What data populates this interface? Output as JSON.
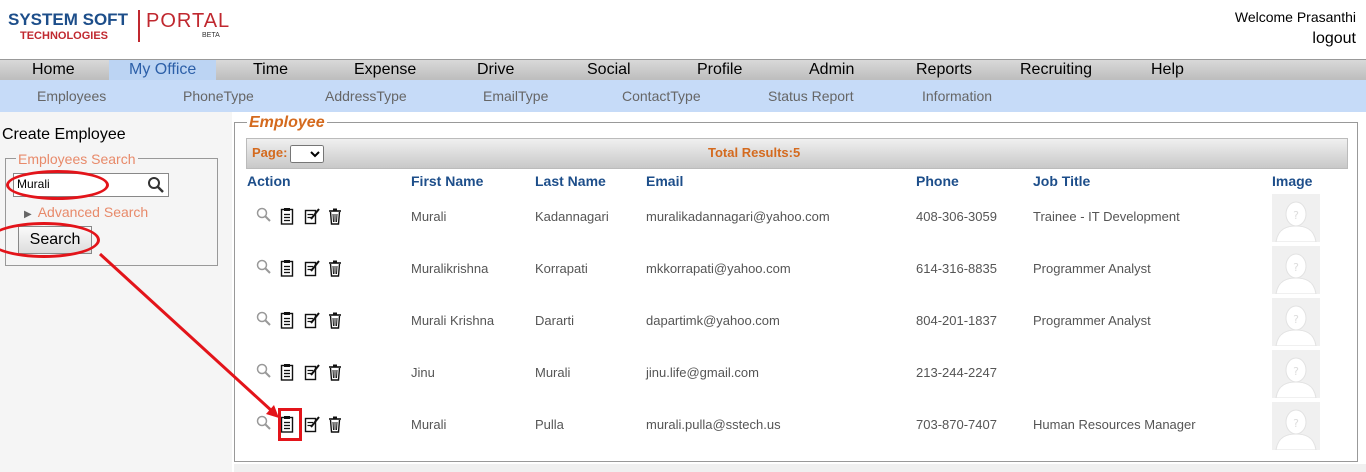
{
  "brand": {
    "line1": "SYSTEM SOFT",
    "line2": "TECHNOLOGIES",
    "portal": "PORTAL",
    "beta": "BETA"
  },
  "user": {
    "welcome": "Welcome Prasanthi",
    "logout": "logout"
  },
  "mainnav": [
    "Home",
    "My Office",
    "Time",
    "Expense",
    "Drive",
    "Social",
    "Profile",
    "Admin",
    "Reports",
    "Recruiting",
    "Help"
  ],
  "mainnav_active": "My Office",
  "subnav": [
    "Employees",
    "PhoneType",
    "AddressType",
    "EmailType",
    "ContactType",
    "Status Report",
    "Information"
  ],
  "left": {
    "create_title": "Create Employee",
    "search_legend": "Employees Search",
    "search_value": "Murali",
    "advanced": "Advanced Search",
    "search_button": "Search"
  },
  "employee": {
    "legend": "Employee",
    "page_label": "Page:",
    "total": "Total Results:5",
    "headers": [
      "Action",
      "First Name",
      "Last Name",
      "Email",
      "Phone",
      "Job Title",
      "Image"
    ],
    "rows": [
      {
        "first": "Murali",
        "last": "Kadannagari",
        "email": "muralikadannagari@yahoo.com",
        "phone": "408-306-3059",
        "job": "Trainee - IT Development"
      },
      {
        "first": "Muralikrishna",
        "last": "Korrapati",
        "email": "mkkorrapati@yahoo.com",
        "phone": "614-316-8835",
        "job": "Programmer Analyst"
      },
      {
        "first": "Murali Krishna",
        "last": "Dararti",
        "email": "dapartimk@yahoo.com",
        "phone": "804-201-1837",
        "job": "Programmer Analyst"
      },
      {
        "first": "Jinu",
        "last": "Murali",
        "email": "jinu.life@gmail.com",
        "phone": "213-244-2247",
        "job": ""
      },
      {
        "first": "Murali",
        "last": "Pulla",
        "email": "murali.pulla@sstech.us",
        "phone": "703-870-7407",
        "job": "Human Resources Manager"
      }
    ]
  },
  "colors": {
    "annotation": "#e3141a",
    "header_text": "#1d4e8a",
    "accent_orange": "#d46a1e"
  }
}
